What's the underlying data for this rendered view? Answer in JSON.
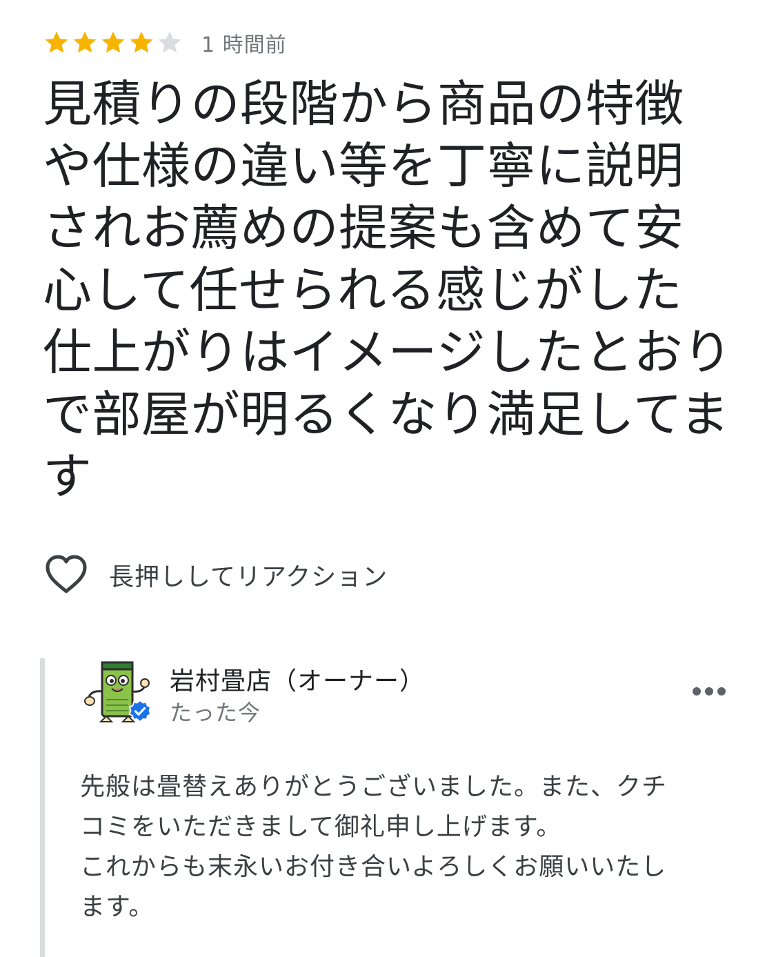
{
  "review": {
    "rating": 4,
    "max_rating": 5,
    "time_ago": "1 時間前",
    "text_lines": [
      "見積りの段階から商品の特徴",
      "や仕様の違い等を丁寧に説明",
      "されお薦めの提案も含めて安",
      "心して任せられる感じがした",
      "仕上がりはイメージしたとおり",
      "で部屋が明るくなり満足してま",
      "す"
    ]
  },
  "reaction": {
    "label": "長押ししてリアクション",
    "icon": "heart-outline-icon"
  },
  "owner_reply": {
    "name": "岩村畳店（オーナー）",
    "time": "たった今",
    "avatar_icon": "tatami-mascot-avatar",
    "badge_icon": "verified-check-icon",
    "menu_icon": "more-horizontal-icon",
    "text_lines": [
      "先般は畳替えありがとうございました。また、クチ",
      "コミをいただきまして御礼申し上げます。",
      "これからも末永いお付き合いよろしくお願いいたし",
      "ます。"
    ]
  },
  "colors": {
    "star_filled": "#F6B400",
    "star_empty": "#DADCE0",
    "verified": "#1A73E8",
    "reply_bar": "#DADCE0",
    "secondary_text": "#70757A"
  }
}
